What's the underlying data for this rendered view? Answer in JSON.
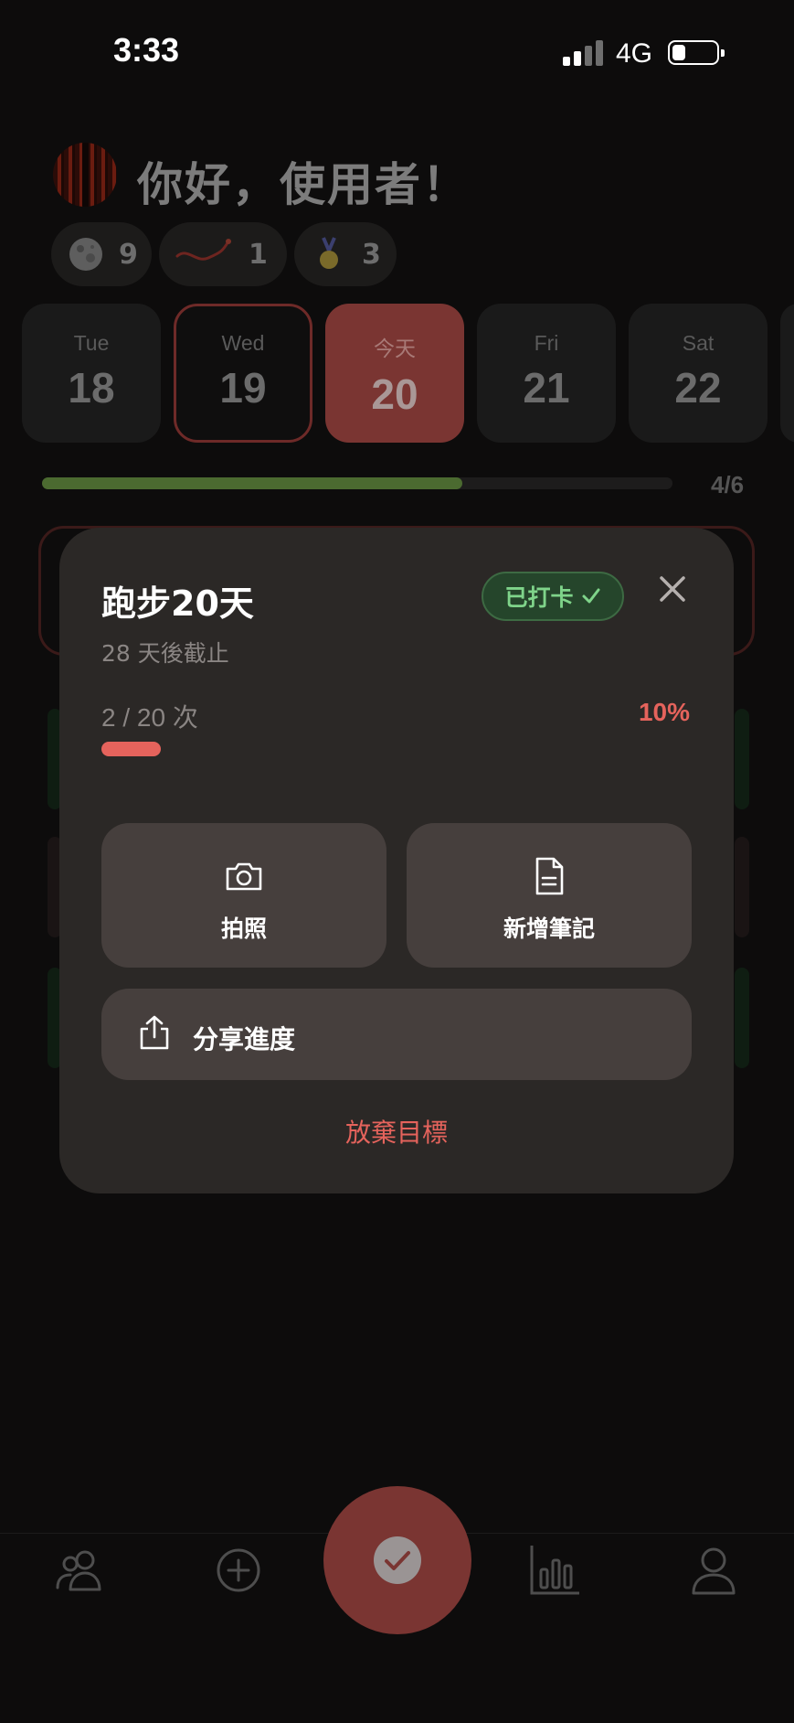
{
  "status_bar": {
    "time": "3:33",
    "network": "4G"
  },
  "header": {
    "greeting": "你好，使用者！"
  },
  "badges": [
    {
      "icon": "moon-icon",
      "count": "9"
    },
    {
      "icon": "comet-icon",
      "count": "1"
    },
    {
      "icon": "medal-icon",
      "count": "3"
    }
  ],
  "calendar": {
    "days": [
      {
        "name": "Tue",
        "date": "18"
      },
      {
        "name": "Wed",
        "date": "19"
      },
      {
        "name": "今天",
        "date": "20"
      },
      {
        "name": "Fri",
        "date": "21"
      },
      {
        "name": "Sat",
        "date": "22"
      }
    ],
    "selected_index": 1,
    "today_index": 2
  },
  "daily_progress": {
    "text": "4/6",
    "completed": 4,
    "total": 6
  },
  "modal": {
    "title": "跑步20天",
    "subtitle": "28 天後截止",
    "status_label": "已打卡",
    "count_text": "2 / 20 次",
    "percent_text": "10%",
    "progress_fraction": 0.1,
    "actions": {
      "photo_label": "拍照",
      "note_label": "新增筆記",
      "share_label": "分享進度"
    },
    "abandon_label": "放棄目標"
  },
  "colors": {
    "accent": "#e5635c",
    "done_green": "#7fd48a",
    "progress_green": "#4b6a30",
    "fab": "#7a3532"
  },
  "bottom_nav": [
    "friends-icon",
    "add-circle-icon",
    "check-icon",
    "stats-icon",
    "profile-icon"
  ]
}
